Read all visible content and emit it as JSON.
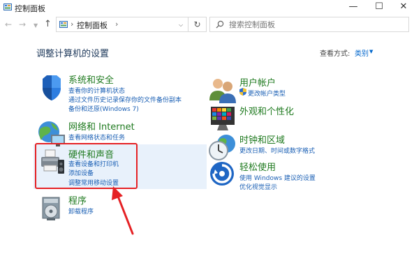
{
  "window": {
    "title": "控制面板",
    "minimize": "—",
    "maximize": "☐",
    "close": "✕"
  },
  "address": {
    "path": "控制面板",
    "search_placeholder": "搜索控制面板"
  },
  "page": {
    "title": "调整计算机的设置",
    "view_by_label": "查看方式:",
    "view_by_value": "类别"
  },
  "left_categories": [
    {
      "title": "系统和安全",
      "icon": "shield-icon",
      "links": [
        "查看你的计算机状态",
        "通过文件历史记录保存你的文件备份副本",
        "备份和还原(Windows 7)"
      ]
    },
    {
      "title": "网络和 Internet",
      "icon": "network-globe-icon",
      "links": [
        "查看网络状态和任务"
      ]
    },
    {
      "title": "硬件和声音",
      "icon": "printer-speaker-icon",
      "links": [
        "查看设备和打印机",
        "添加设备",
        "调整常用移动设置"
      ]
    },
    {
      "title": "程序",
      "icon": "programs-disk-icon",
      "links": [
        "卸载程序"
      ]
    }
  ],
  "right_categories": [
    {
      "title": "用户帐户",
      "icon": "users-icon",
      "links": [
        "更改帐户类型"
      ]
    },
    {
      "title": "外观和个性化",
      "icon": "appearance-monitor-icon",
      "links": []
    },
    {
      "title": "时钟和区域",
      "icon": "clock-globe-icon",
      "links": [
        "更改日期、时间或数字格式"
      ]
    },
    {
      "title": "轻松使用",
      "icon": "ease-of-access-icon",
      "links": [
        "使用 Windows 建议的设置",
        "优化视觉显示"
      ]
    }
  ],
  "colors": {
    "category_title": "#1f7a1f",
    "link": "#1a5fb4",
    "highlight_border": "#e52124",
    "page_title": "#1e395b"
  }
}
